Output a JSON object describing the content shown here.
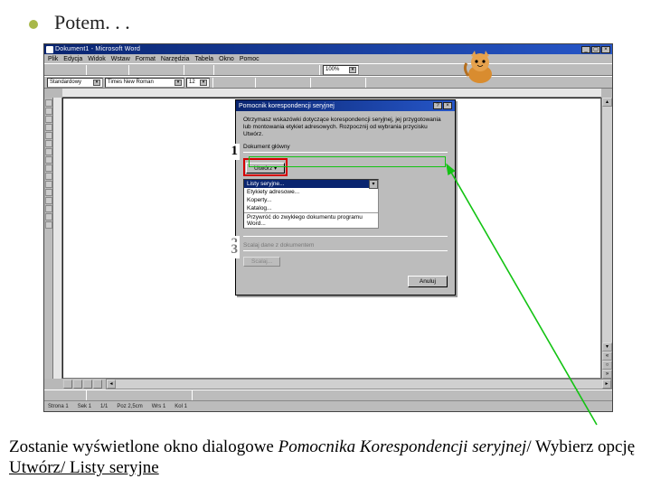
{
  "slide": {
    "title": "Potem. . .",
    "caption_part1": "Zostanie wyświetlone okno dialogowe ",
    "caption_em": "Pomocnika Korespondencji seryjnej",
    "caption_part2": "/ Wybierz opcję ",
    "caption_u": "Utwórz/ Listy seryjne"
  },
  "word": {
    "title": "Dokument1 - Microsoft Word",
    "menus": [
      "Plik",
      "Edycja",
      "Widok",
      "Wstaw",
      "Format",
      "Narzędzia",
      "Tabela",
      "Okno",
      "Pomoc"
    ],
    "style_combo": "Standardowy",
    "font_combo": "Times New Roman",
    "size_combo": "12",
    "zoom_combo": "100%",
    "status": {
      "page": "Strona 1",
      "sec": "Sek 1",
      "of": "1/1",
      "pos": "Poz 2,5cm",
      "line": "Wrs 1",
      "col": "Kol 1"
    }
  },
  "dialog": {
    "title": "Pomocnik korespondencji seryjnej",
    "help_icon": "?",
    "close_icon": "×",
    "instruction": "Otrzymasz wskazówki dotyczące korespondencji seryjnej, jej przygotowania lub montowania etykiet adresowych. Rozpocznij od wybrania przycisku Utwórz.",
    "sections": {
      "s1": {
        "num": "1",
        "label": "Dokument główny",
        "button": "Utwórz"
      },
      "s2": {
        "num": "2",
        "selected": "Listy seryjne...",
        "items": [
          "Etykiety adresowe...",
          "Koperty...",
          "Katalog...",
          "Przywróć do zwykłego dokumentu programu Word..."
        ]
      },
      "s3": {
        "num": "3",
        "label": "Scalaj dane z dokumentem",
        "button": "Scalaj..."
      }
    },
    "close_btn": "Anuluj"
  }
}
